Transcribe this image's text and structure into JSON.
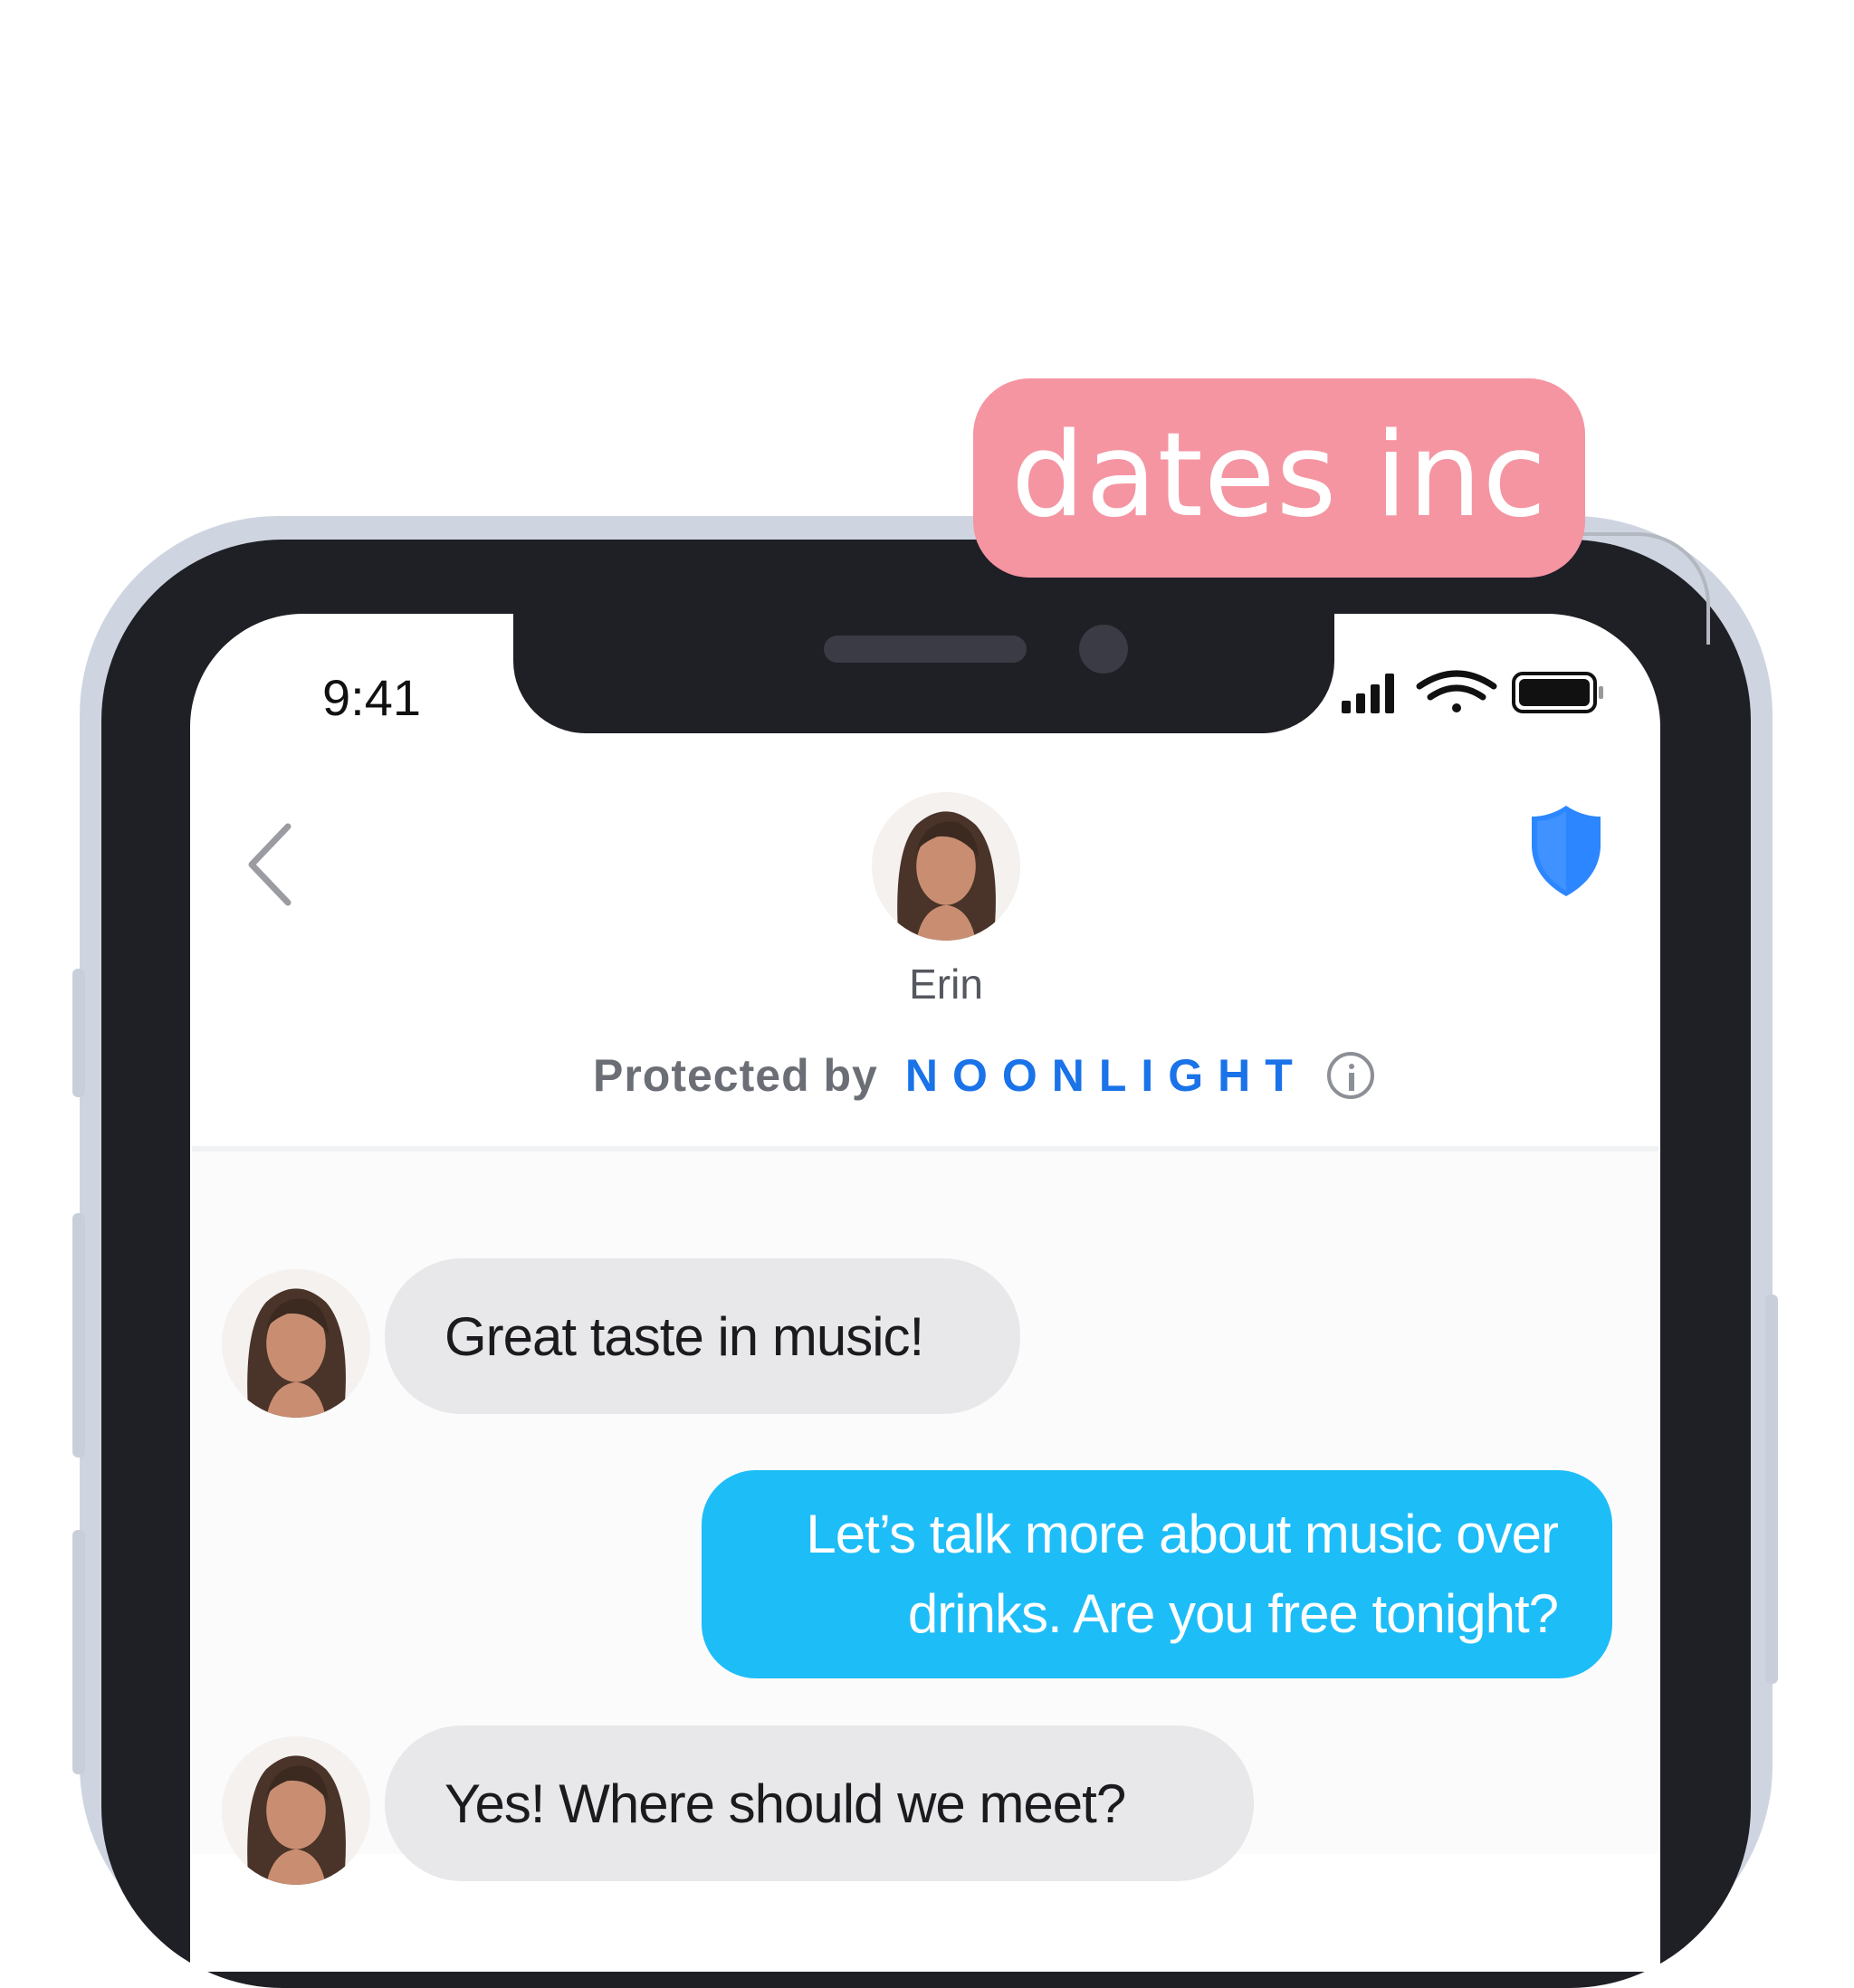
{
  "brand": {
    "name": "dates inc",
    "color": "#f595a2"
  },
  "status_bar": {
    "time": "9:41",
    "icons": [
      "cellular-signal-icon",
      "wifi-icon",
      "battery-icon"
    ]
  },
  "header": {
    "back_icon": "chevron-left-icon",
    "safety_icon": "shield-icon",
    "contact_name": "Erin",
    "protected_by": "Protected by",
    "partner": "NOONLIGHT",
    "info_icon": "info-icon"
  },
  "messages": [
    {
      "sender": "Erin",
      "direction": "incoming",
      "text": "Great taste in music!"
    },
    {
      "sender": "me",
      "direction": "outgoing",
      "text_line1": "Let’s talk more about music over",
      "text_line2": "drinks. Are you free tonight?"
    },
    {
      "sender": "Erin",
      "direction": "incoming",
      "text": "Yes! Where should we meet?"
    }
  ],
  "colors": {
    "outgoing_bubble": "#1dbdf8",
    "incoming_bubble": "#e8e8ea",
    "noonlight_blue": "#1a73e8",
    "shield_blue": "#2b86ff",
    "bezel": "#1f1f26"
  }
}
